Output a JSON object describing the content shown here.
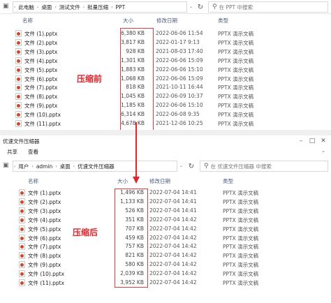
{
  "win1": {
    "breadcrumb": [
      "此电脑",
      "桌面",
      "测试文件",
      "批量压缩",
      "PPT"
    ],
    "search_placeholder": "在 PPT 中搜索",
    "columns": {
      "name": "名称",
      "size": "大小",
      "date": "修改日期",
      "type": "类型"
    },
    "label": "压缩前",
    "files": [
      {
        "name": "文件 (1).pptx",
        "size": "6,380 KB",
        "date": "2022-06-06 11:54",
        "type": "PPTX 演示文稿"
      },
      {
        "name": "文件 (2).pptx",
        "size": "3,817 KB",
        "date": "2022-01-17 9:13",
        "type": "PPTX 演示文稿"
      },
      {
        "name": "文件 (3).pptx",
        "size": "928 KB",
        "date": "2021-08-03 17:40",
        "type": "PPTX 演示文稿"
      },
      {
        "name": "文件 (4).pptx",
        "size": "1,301 KB",
        "date": "2022-06-06 15:09",
        "type": "PPTX 演示文稿"
      },
      {
        "name": "文件 (5).pptx",
        "size": "1,883 KB",
        "date": "2022-06-06 15:10",
        "type": "PPTX 演示文稿"
      },
      {
        "name": "文件 (6).pptx",
        "size": "1,068 KB",
        "date": "2022-06-06 15:09",
        "type": "PPTX 演示文稿"
      },
      {
        "name": "文件 (7).pptx",
        "size": "818 KB",
        "date": "2021-10-11 16:44",
        "type": "PPTX 演示文稿"
      },
      {
        "name": "文件 (8).pptx",
        "size": "1,045 KB",
        "date": "2022-06-09 10:37",
        "type": "PPTX 演示文稿"
      },
      {
        "name": "文件 (9).pptx",
        "size": "1,185 KB",
        "date": "2022-06-06 15:10",
        "type": "PPTX 演示文稿"
      },
      {
        "name": "文件 (10).pptx",
        "size": "6,314 KB",
        "date": "2022-06-08 9:35",
        "type": "PPTX 演示文稿"
      },
      {
        "name": "文件 (11).pptx",
        "size": "4,678 KB",
        "date": "2021-12-06 10:25",
        "type": "PPTX 演示文稿"
      }
    ]
  },
  "win2": {
    "title": "优速文件压缩器",
    "ribbon": {
      "share": "共享",
      "view": "查看"
    },
    "breadcrumb": [
      "用户",
      "admin",
      "桌面",
      "优速文件压缩器"
    ],
    "search_placeholder": "在 优速文件压缩器 中搜索",
    "columns": {
      "name": "名称",
      "size": "大小",
      "date": "修改日期",
      "type": "类型"
    },
    "label": "压缩后",
    "files": [
      {
        "name": "文件 (1).pptx",
        "size": "1,496 KB",
        "date": "2022-07-04 14:41",
        "type": "PPTX 演示文稿"
      },
      {
        "name": "文件 (2).pptx",
        "size": "1,133 KB",
        "date": "2022-07-04 14:41",
        "type": "PPTX 演示文稿"
      },
      {
        "name": "文件 (3).pptx",
        "size": "526 KB",
        "date": "2022-07-04 14:41",
        "type": "PPTX 演示文稿"
      },
      {
        "name": "文件 (4).pptx",
        "size": "351 KB",
        "date": "2022-07-04 14:42",
        "type": "PPTX 演示文稿"
      },
      {
        "name": "文件 (5).pptx",
        "size": "707 KB",
        "date": "2022-07-04 14:42",
        "type": "PPTX 演示文稿"
      },
      {
        "name": "文件 (6).pptx",
        "size": "459 KB",
        "date": "2022-07-04 14:42",
        "type": "PPTX 演示文稿"
      },
      {
        "name": "文件 (7).pptx",
        "size": "757 KB",
        "date": "2022-07-04 14:42",
        "type": "PPTX 演示文稿"
      },
      {
        "name": "文件 (8).pptx",
        "size": "821 KB",
        "date": "2022-07-04 14:42",
        "type": "PPTX 演示文稿"
      },
      {
        "name": "文件 (9).pptx",
        "size": "580 KB",
        "date": "2022-07-04 14:42",
        "type": "PPTX 演示文稿"
      },
      {
        "name": "文件 (10).pptx",
        "size": "2,039 KB",
        "date": "2022-07-04 14:42",
        "type": "PPTX 演示文稿"
      },
      {
        "name": "文件 (11).pptx",
        "size": "3,952 KB",
        "date": "2022-07-04 14:42",
        "type": "PPTX 演示文稿"
      }
    ]
  },
  "colors": {
    "highlight": "#e0262d",
    "header_text": "#4a5a7a"
  }
}
